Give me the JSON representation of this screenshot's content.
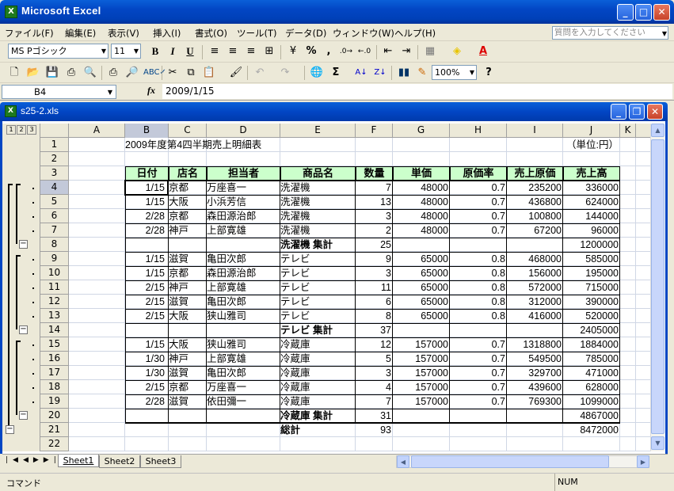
{
  "app": {
    "title": "Microsoft Excel",
    "icon": "X"
  },
  "menu": [
    "ファイル(F)",
    "編集(E)",
    "表示(V)",
    "挿入(I)",
    "書式(O)",
    "ツール(T)",
    "データ(D)",
    "ウィンドウ(W)",
    "ヘルプ(H)"
  ],
  "help_placeholder": "質問を入力してください",
  "toolbar": {
    "font": "MS Pゴシック",
    "size": "11",
    "zoom": "100%"
  },
  "formula": {
    "name_box": "B4",
    "fx": "fx",
    "value": "2009/1/15"
  },
  "workbook": {
    "title": "s25-2.xls"
  },
  "outline_levels": [
    "1",
    "2",
    "3"
  ],
  "columns": [
    "A",
    "B",
    "C",
    "D",
    "E",
    "F",
    "G",
    "H",
    "I",
    "J",
    "K"
  ],
  "rows": [
    "1",
    "2",
    "3",
    "4",
    "5",
    "6",
    "7",
    "8",
    "9",
    "10",
    "11",
    "12",
    "13",
    "14",
    "15",
    "16",
    "17",
    "18",
    "19",
    "20",
    "21",
    "22"
  ],
  "sheet": {
    "title": "2009年度第4四半期売上明細表",
    "unit": "（単位:円）",
    "headers": [
      "日付",
      "店名",
      "担当者",
      "商品名",
      "数量",
      "単価",
      "原価率",
      "売上原価",
      "売上高"
    ],
    "data": [
      [
        "1/15",
        "京都",
        "万座喜一",
        "洗濯機",
        "7",
        "48000",
        "0.7",
        "235200",
        "336000"
      ],
      [
        "1/15",
        "大阪",
        "小浜芳信",
        "洗濯機",
        "13",
        "48000",
        "0.7",
        "436800",
        "624000"
      ],
      [
        "2/28",
        "京都",
        "森田源治郎",
        "洗濯機",
        "3",
        "48000",
        "0.7",
        "100800",
        "144000"
      ],
      [
        "2/28",
        "神戸",
        "上部寛雄",
        "洗濯機",
        "2",
        "48000",
        "0.7",
        "67200",
        "96000"
      ],
      [
        "",
        "",
        "",
        "洗濯機 集計",
        "25",
        "",
        "",
        "",
        "1200000"
      ],
      [
        "1/15",
        "滋賀",
        "亀田次郎",
        "テレビ",
        "9",
        "65000",
        "0.8",
        "468000",
        "585000"
      ],
      [
        "1/15",
        "京都",
        "森田源治郎",
        "テレビ",
        "3",
        "65000",
        "0.8",
        "156000",
        "195000"
      ],
      [
        "2/15",
        "神戸",
        "上部寛雄",
        "テレビ",
        "11",
        "65000",
        "0.8",
        "572000",
        "715000"
      ],
      [
        "2/15",
        "滋賀",
        "亀田次郎",
        "テレビ",
        "6",
        "65000",
        "0.8",
        "312000",
        "390000"
      ],
      [
        "2/15",
        "大阪",
        "狭山雅司",
        "テレビ",
        "8",
        "65000",
        "0.8",
        "416000",
        "520000"
      ],
      [
        "",
        "",
        "",
        "テレビ 集計",
        "37",
        "",
        "",
        "",
        "2405000"
      ],
      [
        "1/15",
        "大阪",
        "狭山雅司",
        "冷蔵庫",
        "12",
        "157000",
        "0.7",
        "1318800",
        "1884000"
      ],
      [
        "1/30",
        "神戸",
        "上部寛雄",
        "冷蔵庫",
        "5",
        "157000",
        "0.7",
        "549500",
        "785000"
      ],
      [
        "1/30",
        "滋賀",
        "亀田次郎",
        "冷蔵庫",
        "3",
        "157000",
        "0.7",
        "329700",
        "471000"
      ],
      [
        "2/15",
        "京都",
        "万座喜一",
        "冷蔵庫",
        "4",
        "157000",
        "0.7",
        "439600",
        "628000"
      ],
      [
        "2/28",
        "滋賀",
        "依田彌一",
        "冷蔵庫",
        "7",
        "157000",
        "0.7",
        "769300",
        "1099000"
      ],
      [
        "",
        "",
        "",
        "冷蔵庫 集計",
        "31",
        "",
        "",
        "",
        "4867000"
      ],
      [
        "",
        "",
        "",
        "総計",
        "93",
        "",
        "",
        "",
        "8472000"
      ]
    ]
  },
  "tabs": [
    "Sheet1",
    "Sheet2",
    "Sheet3"
  ],
  "status": {
    "left": "コマンド",
    "right": "NUM"
  }
}
